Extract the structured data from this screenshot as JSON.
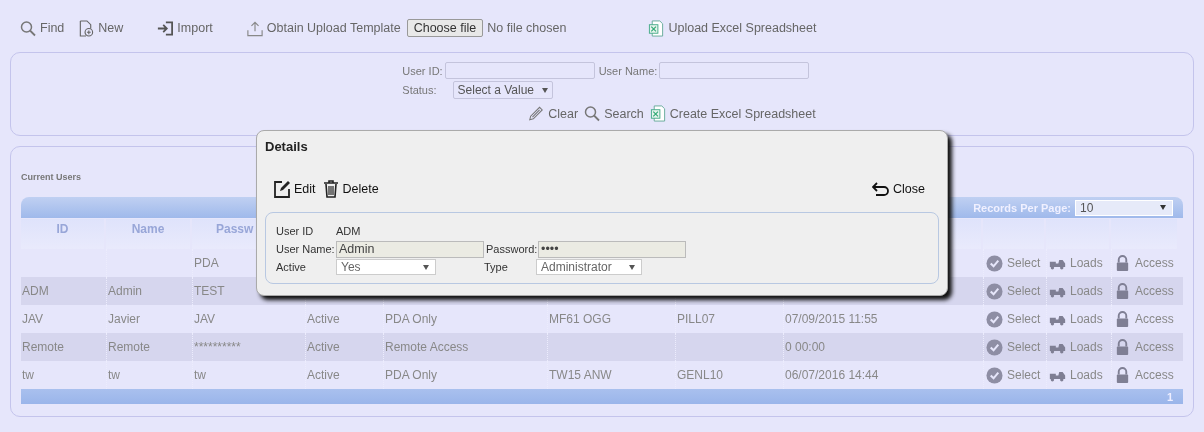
{
  "toolbar": {
    "buttons": [
      {
        "label": "Find",
        "kind": "find"
      },
      {
        "label": "New",
        "kind": "new"
      },
      {
        "label": "Import",
        "kind": "import"
      },
      {
        "label": "Obtain Upload Template",
        "kind": "template"
      }
    ],
    "file_input": {
      "button": "Choose file",
      "status": "No file chosen"
    },
    "upload": {
      "label": "Upload Excel Spreadsheet"
    }
  },
  "search_panel": {
    "fields": [
      {
        "label": "User ID:"
      },
      {
        "label": "User Name:"
      }
    ],
    "status": {
      "label": "Status:",
      "value": "Select a Value"
    },
    "actions": [
      {
        "label": "Clear",
        "kind": "clear"
      },
      {
        "label": "Search",
        "kind": "search"
      },
      {
        "label": "Create Excel Spreadsheet",
        "kind": "excel"
      }
    ]
  },
  "users": {
    "title": "Current Users",
    "records_per_page": {
      "label": "Records Per Page:",
      "value": "10"
    },
    "columns": [
      "ID",
      "Name",
      "Passw"
    ],
    "rows": [
      {
        "password": "PDA",
        "actions": [
          {
            "label": "Select",
            "kind": "select"
          },
          {
            "label": "Loads",
            "kind": "loads"
          },
          {
            "label": "Access",
            "kind": "access"
          }
        ]
      },
      {
        "id": "ADM",
        "name": "Admin",
        "password": "TEST",
        "actions": [
          {
            "label": "Select",
            "kind": "select"
          },
          {
            "label": "Loads",
            "kind": "loads"
          },
          {
            "label": "Access",
            "kind": "access"
          }
        ]
      },
      {
        "id": "JAV",
        "name": "Javier",
        "password": "JAV",
        "status": "Active",
        "type": "PDA Only",
        "column_6": "MF61 OGG",
        "column_7": "PILL07",
        "column_8": "07/09/2015 11:55",
        "actions": [
          {
            "label": "Select",
            "kind": "select"
          },
          {
            "label": "Loads",
            "kind": "loads"
          },
          {
            "label": "Access",
            "kind": "access"
          }
        ]
      },
      {
        "id": "Remote",
        "name": "Remote",
        "password": "**********",
        "status": "Active",
        "type": "Remote Access",
        "column_8": "0 00:00",
        "actions": [
          {
            "label": "Select",
            "kind": "select"
          },
          {
            "label": "Loads",
            "kind": "loads"
          },
          {
            "label": "Access",
            "kind": "access"
          }
        ]
      },
      {
        "id": "tw",
        "name": "tw",
        "password": "tw",
        "status": "Active",
        "type": "PDA Only",
        "column_6": "TW15 ANW",
        "column_7": "GENL10",
        "column_8": "06/07/2016 14:44",
        "actions": [
          {
            "label": "Select",
            "kind": "select"
          },
          {
            "label": "Loads",
            "kind": "loads"
          },
          {
            "label": "Access",
            "kind": "access"
          }
        ]
      }
    ],
    "pager": "1"
  },
  "details": {
    "title": "Details",
    "actions": [
      {
        "label": "Edit",
        "kind": "edit"
      },
      {
        "label": "Delete",
        "kind": "delete"
      }
    ],
    "close": "Close",
    "user_id": {
      "label": "User ID",
      "value": "ADM"
    },
    "user_name": {
      "label": "User Name:",
      "value": "Admin"
    },
    "password": {
      "label": "Password:",
      "value": "••••"
    },
    "active": {
      "label": "Active",
      "value": "Yes"
    },
    "type": {
      "label": "Type",
      "value": "Administrator"
    }
  }
}
